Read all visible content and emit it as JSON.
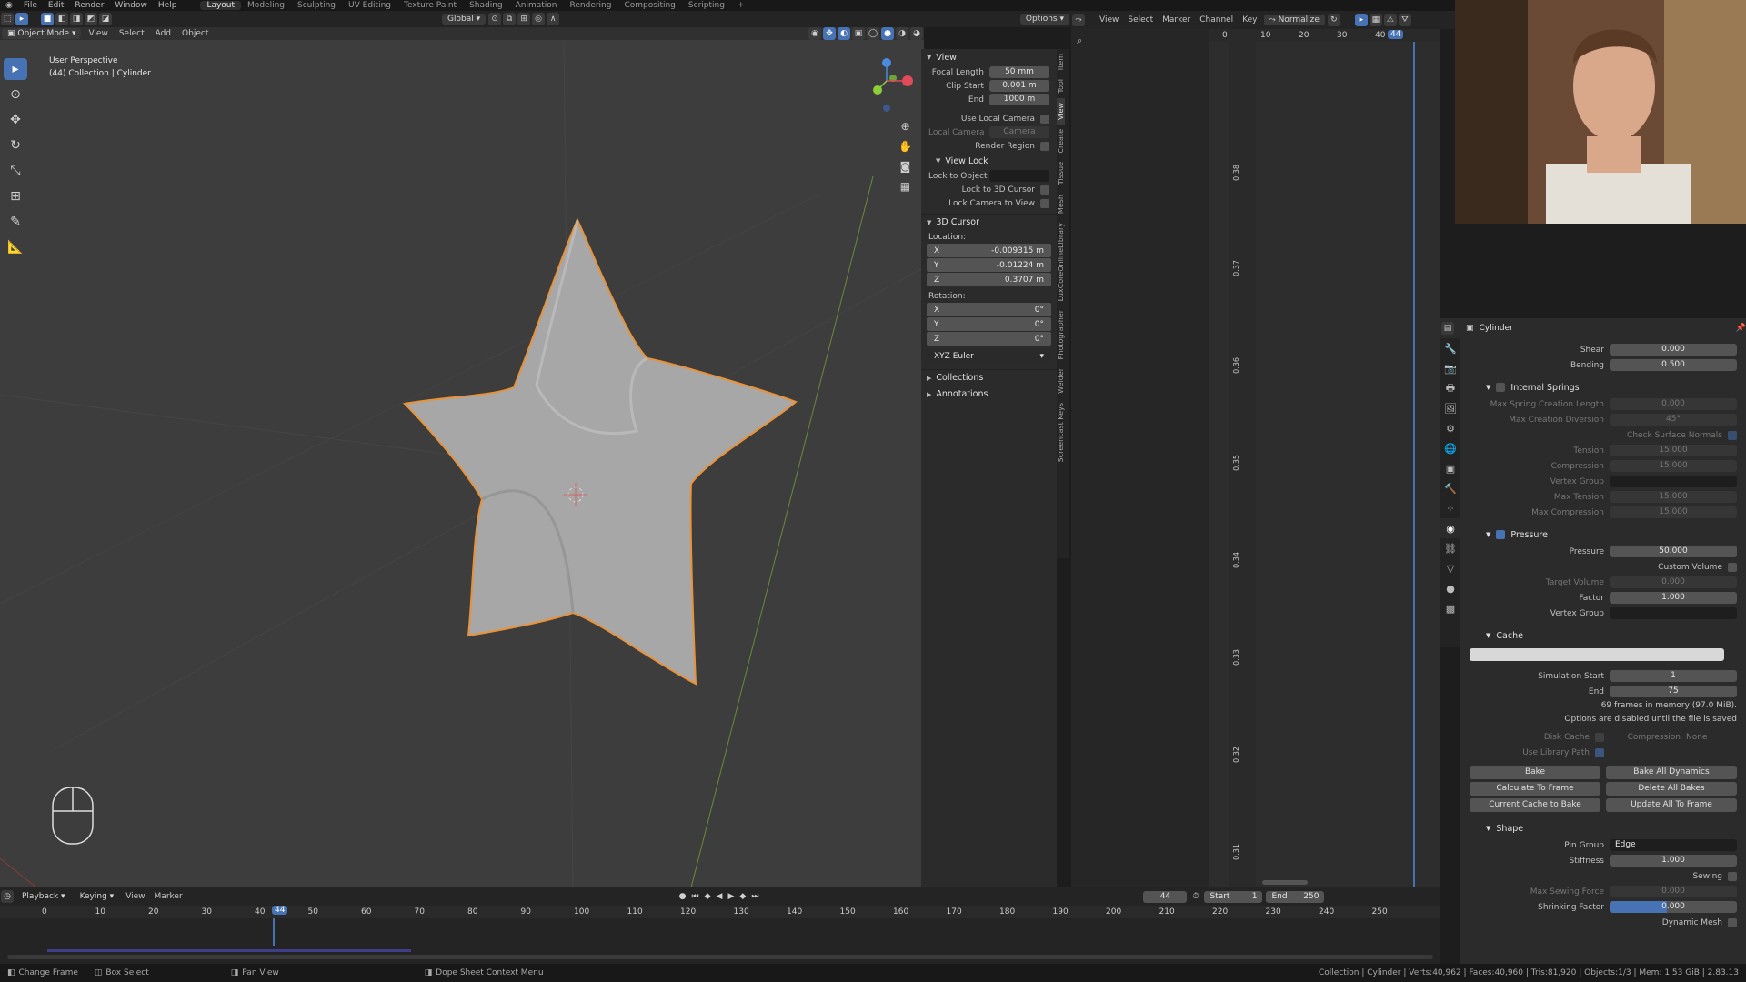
{
  "topmenu": {
    "items": [
      "File",
      "Edit",
      "Render",
      "Window",
      "Help"
    ],
    "workspaces": [
      "Layout",
      "Modeling",
      "Sculpting",
      "UV Editing",
      "Texture Paint",
      "Shading",
      "Animation",
      "Rendering",
      "Compositing",
      "Scripting",
      "+"
    ]
  },
  "viewport_header": {
    "mode": "Object Mode",
    "menus": [
      "View",
      "Select",
      "Add",
      "Object"
    ],
    "transform_orientation": "Global",
    "options": "Options"
  },
  "viewport": {
    "title": "User Perspective",
    "subtitle": "(44) Collection | Cylinder"
  },
  "npanel": {
    "view_section": "View",
    "focal_length_label": "Focal Length",
    "focal_length": "50 mm",
    "clip_start_label": "Clip Start",
    "clip_start": "0.001 m",
    "end_label": "End",
    "clip_end": "1000 m",
    "use_local_camera": "Use Local Camera",
    "local_camera_label": "Local Camera",
    "local_camera_value": "Camera",
    "render_region": "Render Region",
    "view_lock": "View Lock",
    "lock_to_object": "Lock to Object",
    "lock_3d_cursor": "Lock to 3D Cursor",
    "lock_camera": "Lock Camera to View",
    "cursor_section": "3D Cursor",
    "location_label": "Location:",
    "loc_x": "-0.009315 m",
    "loc_y": "-0.01224 m",
    "loc_z": "0.3707 m",
    "rotation_label": "Rotation:",
    "rot_x": "0°",
    "rot_y": "0°",
    "rot_z": "0°",
    "rotation_mode": "XYZ Euler",
    "collections": "Collections",
    "annotations": "Annotations",
    "tabs": [
      "Item",
      "Tool",
      "View",
      "Create",
      "Tissue",
      "Mesh",
      "LuxCoreOnlineLibrary",
      "Photographer",
      "Welder",
      "Screencast Keys"
    ]
  },
  "graph_editor": {
    "menus": [
      "View",
      "Select",
      "Marker",
      "Channel",
      "Key"
    ],
    "normalize": "Normalize",
    "frame_ticks": [
      "0",
      "10",
      "20",
      "30",
      "40"
    ],
    "current_frame": "44",
    "value_ticks": [
      "0.38",
      "0.37",
      "0.36",
      "0.35",
      "0.34",
      "0.33",
      "0.32",
      "0.31"
    ]
  },
  "properties": {
    "object_name": "Cylinder",
    "shear_label": "Shear",
    "shear": "0.000",
    "bending_label": "Bending",
    "bending": "0.500",
    "internal_springs": "Internal Springs",
    "max_spring_label": "Max Spring Creation Length",
    "max_spring": "0.000",
    "max_diversion_label": "Max Creation Diversion",
    "max_diversion": "45°",
    "check_normals": "Check Surface Normals",
    "tension_label": "Tension",
    "tension": "15.000",
    "compression_label": "Compression",
    "compression": "15.000",
    "vertex_group_label": "Vertex Group",
    "max_tension_label": "Max Tension",
    "max_tension": "15.000",
    "max_compression_label": "Max Compression",
    "max_compression": "15.000",
    "pressure_section": "Pressure",
    "pressure_label": "Pressure",
    "pressure": "50.000",
    "custom_volume": "Custom Volume",
    "target_volume_label": "Target Volume",
    "target_volume": "0.000",
    "factor_label": "Factor",
    "factor": "1.000",
    "vertex_group2_label": "Vertex Group",
    "cache_section": "Cache",
    "sim_start_label": "Simulation Start",
    "sim_start": "1",
    "sim_end_label": "End",
    "sim_end": "75",
    "frames_in_memory": "69 frames in memory (97.0 MiB).",
    "options_disabled": "Options are disabled until the file is saved",
    "disk_cache": "Disk Cache",
    "compression2_label": "Compression",
    "compression2": "None",
    "use_library_path": "Use Library Path",
    "bake": "Bake",
    "bake_all": "Bake All Dynamics",
    "calc_to_frame": "Calculate To Frame",
    "delete_all_bakes": "Delete All Bakes",
    "current_cache_to_bake": "Current Cache to Bake",
    "update_all_to_frame": "Update All To Frame",
    "shape_section": "Shape",
    "pin_group_label": "Pin Group",
    "pin_group": "Edge",
    "stiffness_label": "Stiffness",
    "stiffness": "1.000",
    "sewing": "Sewing",
    "max_sewing_label": "Max Sewing Force",
    "max_sewing": "0.000",
    "shrinking_label": "Shrinking Factor",
    "shrinking": "0.000",
    "shrinking_fill": 0.45,
    "dynamic_mesh": "Dynamic Mesh"
  },
  "timeline": {
    "menus": [
      "Playback",
      "Keying",
      "View",
      "Marker"
    ],
    "current_frame": "44",
    "start_label": "Start",
    "start": "1",
    "end_label": "End",
    "end": "250",
    "ticks": [
      "0",
      "10",
      "20",
      "30",
      "40",
      "50",
      "60",
      "70",
      "80",
      "90",
      "100",
      "110",
      "120",
      "130",
      "140",
      "150",
      "160",
      "170",
      "180",
      "190",
      "200",
      "210",
      "220",
      "230",
      "240",
      "250"
    ]
  },
  "statusbar": {
    "change_frame": "Change Frame",
    "box_select": "Box Select",
    "pan_view": "Pan View",
    "context_menu": "Dope Sheet Context Menu",
    "stats": "Collection | Cylinder | Verts:40,962 | Faces:40,960 | Tris:81,920 | Objects:1/3 | Mem: 1.53 GiB | 2.83.13"
  },
  "colors": {
    "accent": "#4772b3",
    "selection_outline": "#e8923a",
    "viewport_bg": "#3d3d3d"
  }
}
